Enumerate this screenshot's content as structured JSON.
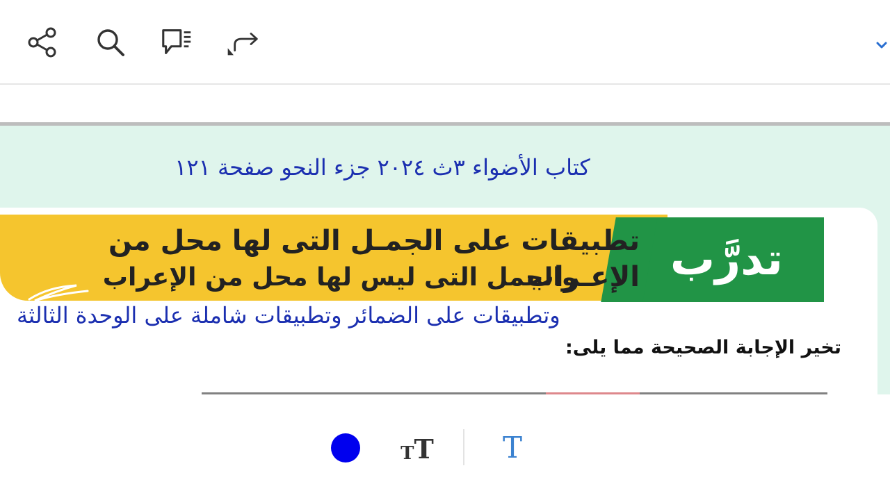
{
  "toolbar": {
    "icons": [
      "share-icon",
      "search-icon",
      "comments-icon",
      "redo-icon"
    ],
    "collapse_icon": "chevron-down-icon"
  },
  "document": {
    "handwritten_title": "كتاب الأضواء ٣ث ٢٠٢٤ جزء النحو صفحة ١٢١",
    "train_label": "تدرَّب",
    "headline_line1": "تطبيقات على الجمـل التى لها محل من الإعـراب",
    "headline_line2": "والجمل التى ليس لها محل من الإعراب",
    "handwritten_subtitle": "وتطبيقات على الضمائر وتطبيقات شاملة على الوحدة الثالثة",
    "instruction": "تخير الإجابة الصحيحة مما يلى:"
  },
  "bottom_tools": {
    "color_hex": "#0000ee",
    "text_size_small": "T",
    "text_size_big": "T",
    "text_tool": "T"
  },
  "colors": {
    "page_bg": "#dff5ec",
    "banner_yellow": "#f5c52e",
    "banner_green": "#219446",
    "handwriting": "#1b2fb0",
    "accent": "#3b82d0"
  }
}
